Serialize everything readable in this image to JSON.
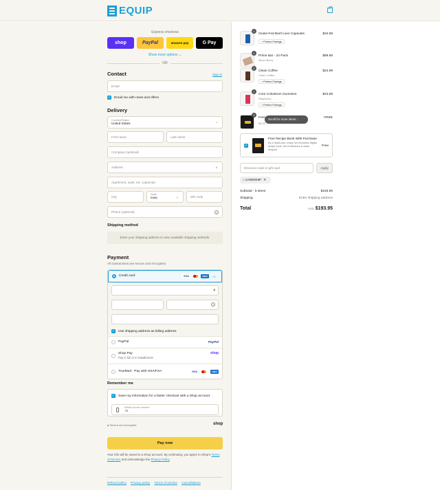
{
  "header": {
    "brand": "EQUIP"
  },
  "express": {
    "title": "Express checkout",
    "shop": "shop",
    "paypal": "PayPal",
    "amazon": "amazon pay",
    "gpay": "G Pay",
    "show_more": "Show more options ⌄",
    "or": "OR"
  },
  "contact": {
    "heading": "Contact",
    "sign_in": "Sign in",
    "email_placeholder": "Email",
    "news_label": "Email me with news and offers"
  },
  "delivery": {
    "heading": "Delivery",
    "country_label": "Country/Region",
    "country_value": "United States",
    "first_name": "First name",
    "last_name": "Last name",
    "company": "Company (optional)",
    "address": "Address",
    "apartment": "Apartment, suite, etc. (optional)",
    "city": "City",
    "state_label": "State",
    "state_value": "Iowa",
    "zip": "ZIP code",
    "phone": "Phone (optional)"
  },
  "shipping": {
    "heading": "Shipping method",
    "note": "Enter your shipping address to view available shipping methods."
  },
  "payment": {
    "heading": "Payment",
    "subtitle": "All transactions are secure and encrypted.",
    "credit_card": "Credit card",
    "more_brands": "+2",
    "billing_label": "Use shipping address as billing address",
    "paypal": "PayPal",
    "shoppay": "Shop Pay",
    "shoppay_sub": "Pay in full or in installments",
    "shop_logo": "shop",
    "truemed": "TrueMed - Pay with HSA/FSA",
    "visa": "VISA",
    "amex": "AMEX"
  },
  "remember": {
    "heading": "Remember me",
    "save_label": "Save my information for a faster checkout with a Shop account",
    "mobile_label": "Mobile phone number",
    "mobile_value": "+1",
    "secure": "Secure and encrypted",
    "shop_logo": "shop"
  },
  "pay_now": "Pay now",
  "legal": {
    "prefix": "Your info will be saved to a Shop account. By continuing, you agree to Shop's ",
    "terms": "Terms of Service",
    "middle": " and acknowledge the ",
    "privacy": "Privacy Policy",
    "suffix": "."
  },
  "footer": [
    "Refund policy",
    "Privacy policy",
    "Terms of service",
    "Cancellations"
  ],
  "cart": {
    "items": [
      {
        "qty": "1",
        "name": "Grass-Fed Beef Liver Capsules",
        "variant": "",
        "pairing": "Perfect Pairings",
        "price": "$34.99",
        "color": "#1f5fa8"
      },
      {
        "qty": "1",
        "name": "Prime Bar - 24 Pack",
        "variant": "Mixed Berry",
        "pairing": "",
        "price": "$89.98",
        "color": "#c7a88c"
      },
      {
        "qty": "1",
        "name": "Clean Coffee",
        "variant": "Clean Coffee",
        "pairing": "Perfect Pairings",
        "price": "$24.99",
        "color": "#5a3322"
      },
      {
        "qty": "1",
        "name": "Core Colostrum Gummies",
        "variant": "Raspberry",
        "pairing": "Perfect Pairings",
        "price": "$43.99",
        "color": "#d8345a"
      },
      {
        "qty": "1",
        "name": "Free",
        "variant": "$0.00",
        "pairing": "",
        "price": "FREE",
        "color": "#1a1a1a"
      }
    ],
    "scroll_hint": "Scroll for more items ↓",
    "upsell": {
      "title": "Free Recipe Book With Purchase",
      "desc": "As a thank-you, enjoy our exclusive digital recipe book: full of delicious & clean recipes!",
      "price": "Free"
    },
    "discount_placeholder": "Discount code or gift card",
    "apply": "Apply",
    "code": "CARMSHIP",
    "subtotal_label": "Subtotal · 5 items",
    "subtotal": "$193.95",
    "shipping_label": "Shipping",
    "shipping_value": "Enter shipping address",
    "total_label": "Total",
    "currency": "USD",
    "total": "$193.95"
  }
}
